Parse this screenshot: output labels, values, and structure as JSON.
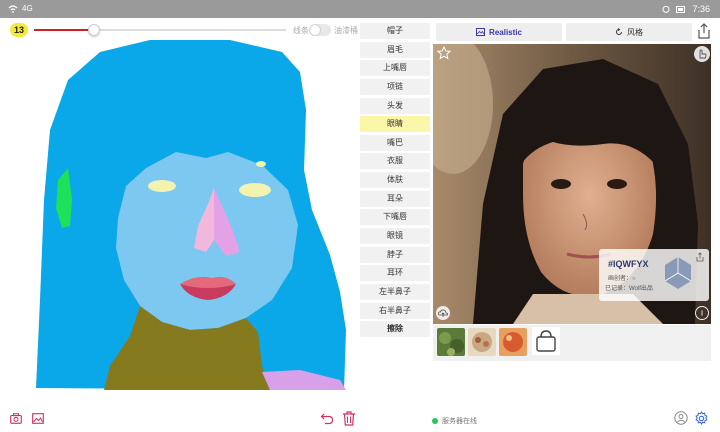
{
  "status_bar": {
    "left_text": "4G",
    "time": "7:36"
  },
  "toolbar": {
    "brush_size": "13",
    "slider_fraction": 0.24,
    "line_mode_label": "线条",
    "fill_mode_label": "油漆桶"
  },
  "labels": [
    {
      "text": "帽子",
      "selected": false
    },
    {
      "text": "眉毛",
      "selected": false
    },
    {
      "text": "上嘴唇",
      "selected": false
    },
    {
      "text": "项链",
      "selected": false
    },
    {
      "text": "头发",
      "selected": false
    },
    {
      "text": "眼睛",
      "selected": true
    },
    {
      "text": "嘴巴",
      "selected": false
    },
    {
      "text": "衣服",
      "selected": false
    },
    {
      "text": "体肤",
      "selected": false
    },
    {
      "text": "耳朵",
      "selected": false
    },
    {
      "text": "下嘴唇",
      "selected": false
    },
    {
      "text": "眼镜",
      "selected": false
    },
    {
      "text": "脖子",
      "selected": false
    },
    {
      "text": "耳环",
      "selected": false
    },
    {
      "text": "左半鼻子",
      "selected": false
    },
    {
      "text": "右半鼻子",
      "selected": false
    },
    {
      "text": "擦除",
      "selected": false
    }
  ],
  "style_buttons": {
    "realistic": "Realistic",
    "style": "风格"
  },
  "info_card": {
    "code": "#IQWFYX",
    "line1": "画创者：○",
    "line2": "已记录：Wolf出品"
  },
  "status": {
    "server": "服务器在线"
  },
  "colors": {
    "hair": "#0aa8e8",
    "skin": "#7cc8f0",
    "neck_clothes": "#857a1e",
    "nose_left": "#f2b8dc",
    "nose_right": "#e3a2e6",
    "lips_upper": "#e4697a",
    "lips_lower": "#c83a5e",
    "eyes": "#f3f3b0",
    "ear": "#1ee05a",
    "slider_fill": "#d02020",
    "selected_label": "#fbf6a8",
    "online": "#22c85a"
  },
  "icons": {
    "camera": "camera-icon",
    "gallery": "image-icon",
    "undo": "undo-icon",
    "delete": "trash-icon",
    "user": "user-icon",
    "settings": "gear-icon",
    "share": "share-icon",
    "star": "star-icon",
    "bag": "shopping-bag-icon"
  }
}
